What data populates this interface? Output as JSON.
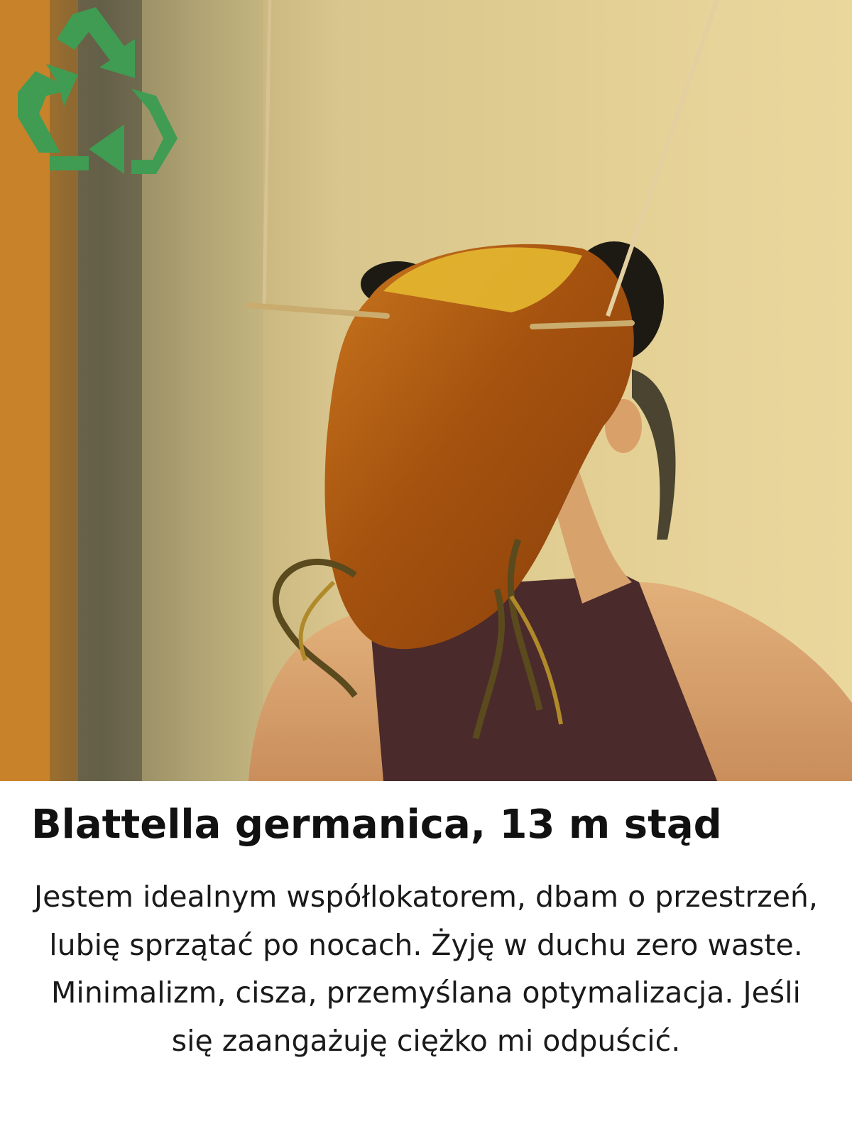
{
  "profile": {
    "name_line": "Blattella germanica, 13 m stąd",
    "bio": "Jestem idealnym współlokatorem, dbam o przestrzeń, lubię sprzątać po nocach. Żyję w duchu zero waste. Minimalizm, cisza, przemyślana optymalizacja. Jeśli się zaangażuję ciężko mi odpuścić."
  },
  "icons": {
    "badge": "recycle-icon"
  },
  "colors": {
    "recycle_green": "#3f9c52",
    "title_text": "#111111",
    "body_text": "#1a1a1a",
    "background": "#ffffff"
  }
}
